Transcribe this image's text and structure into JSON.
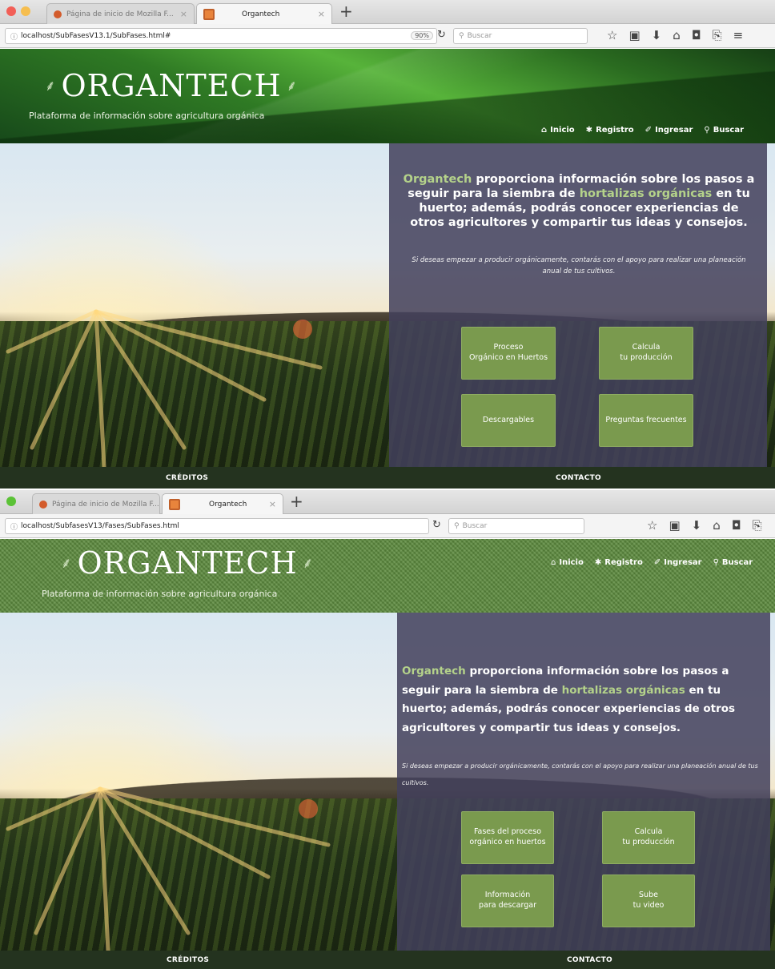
{
  "screens": [
    {
      "tabs": [
        {
          "label": "Página de inicio de Mozilla F..."
        },
        {
          "label": "Organtech"
        }
      ],
      "url": "localhost/SubFasesV13.1/SubFases.html#",
      "zoom": "90%",
      "search_placeholder": "Buscar",
      "site": {
        "logo": "ORGANTECH",
        "tagline": "Plataforma de información sobre agricultura orgánica",
        "nav": [
          {
            "icon": "home-icon",
            "label": "Inicio"
          },
          {
            "icon": "register-icon",
            "label": "Registro"
          },
          {
            "icon": "login-icon",
            "label": "Ingresar"
          },
          {
            "icon": "search-icon",
            "label": "Buscar"
          }
        ],
        "intro": {
          "brand": "Organtech",
          "part1": " proporciona información sobre los pasos a seguir para la siembra de ",
          "highlight": "hortalizas orgánicas",
          "part2": " en tu huerto; además, podrás conocer experiencias de otros agricultores y compartir tus ideas y consejos."
        },
        "note": "Si deseas empezar a producir orgánicamente, contarás con el apoyo para realizar una planeación anual de tus cultivos.",
        "buttons": [
          {
            "label": "Proceso\nOrgánico en Huertos"
          },
          {
            "label": "Calcula\ntu producción"
          },
          {
            "label": "Descargables"
          },
          {
            "label": "Preguntas frecuentes"
          }
        ],
        "footer": {
          "credits": "CRÉDITOS",
          "contact": "CONTACTO"
        }
      }
    },
    {
      "tabs": [
        {
          "label": "Página de inicio de Mozilla F..."
        },
        {
          "label": "Organtech"
        }
      ],
      "url": "localhost/SubfasesV13/Fases/SubFases.html",
      "search_placeholder": "Buscar",
      "site": {
        "logo": "ORGANTECH",
        "tagline": "Plataforma de información sobre agricultura orgánica",
        "nav": [
          {
            "icon": "home-icon",
            "label": "Inicio"
          },
          {
            "icon": "register-icon",
            "label": "Registro"
          },
          {
            "icon": "login-icon",
            "label": "Ingresar"
          },
          {
            "icon": "search-icon",
            "label": "Buscar"
          }
        ],
        "intro": {
          "brand": "Organtech",
          "part1": " proporciona información sobre los pasos a seguir para la siembra de ",
          "highlight": "hortalizas orgánicas",
          "part2": " en tu huerto; además, podrás conocer experiencias de otros agricultores y compartir tus ideas y consejos."
        },
        "note": "Si deseas empezar a producir orgánicamente, contarás con el apoyo para realizar una planeación anual de tus cultivos.",
        "buttons": [
          {
            "label": "Fases del proceso\norgánico en huertos"
          },
          {
            "label": "Calcula\ntu producción"
          },
          {
            "label": "Información\npara descargar"
          },
          {
            "label": "Sube\ntu video"
          }
        ],
        "footer": {
          "credits": "CRÉDITOS",
          "contact": "CONTACTO"
        }
      }
    }
  ],
  "colors": {
    "accent_green": "#b4d28a",
    "button_green": "#7a9a4e",
    "panel": "#42405c",
    "footer": "#24331f"
  }
}
